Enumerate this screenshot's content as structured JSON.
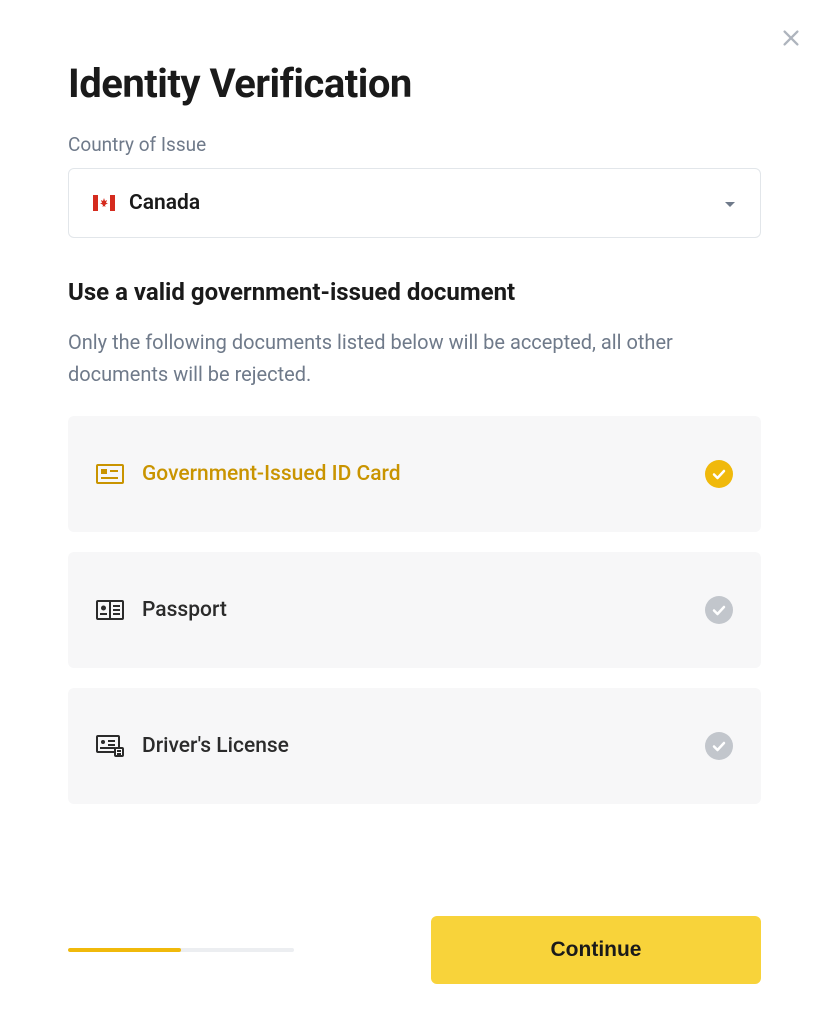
{
  "title": "Identity Verification",
  "country_field": {
    "label": "Country of Issue",
    "selected": "Canada"
  },
  "doc_section": {
    "title": "Use a valid government-issued document",
    "description": "Only the following documents listed below will be accepted, all other documents will be rejected."
  },
  "documents": [
    {
      "label": "Government-Issued ID Card",
      "selected": true
    },
    {
      "label": "Passport",
      "selected": false
    },
    {
      "label": "Driver's License",
      "selected": false
    }
  ],
  "progress_percent": 50,
  "continue_label": "Continue"
}
